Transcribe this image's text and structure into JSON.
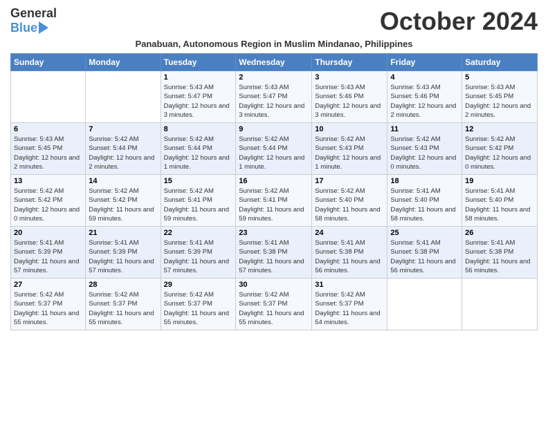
{
  "header": {
    "logo_general": "General",
    "logo_blue": "Blue",
    "month_title": "October 2024",
    "subtitle": "Panabuan, Autonomous Region in Muslim Mindanao, Philippines"
  },
  "days_of_week": [
    "Sunday",
    "Monday",
    "Tuesday",
    "Wednesday",
    "Thursday",
    "Friday",
    "Saturday"
  ],
  "weeks": [
    [
      {
        "day": "",
        "sunrise": "",
        "sunset": "",
        "daylight": ""
      },
      {
        "day": "",
        "sunrise": "",
        "sunset": "",
        "daylight": ""
      },
      {
        "day": "1",
        "sunrise": "Sunrise: 5:43 AM",
        "sunset": "Sunset: 5:47 PM",
        "daylight": "Daylight: 12 hours and 3 minutes."
      },
      {
        "day": "2",
        "sunrise": "Sunrise: 5:43 AM",
        "sunset": "Sunset: 5:47 PM",
        "daylight": "Daylight: 12 hours and 3 minutes."
      },
      {
        "day": "3",
        "sunrise": "Sunrise: 5:43 AM",
        "sunset": "Sunset: 5:46 PM",
        "daylight": "Daylight: 12 hours and 3 minutes."
      },
      {
        "day": "4",
        "sunrise": "Sunrise: 5:43 AM",
        "sunset": "Sunset: 5:46 PM",
        "daylight": "Daylight: 12 hours and 2 minutes."
      },
      {
        "day": "5",
        "sunrise": "Sunrise: 5:43 AM",
        "sunset": "Sunset: 5:45 PM",
        "daylight": "Daylight: 12 hours and 2 minutes."
      }
    ],
    [
      {
        "day": "6",
        "sunrise": "Sunrise: 5:43 AM",
        "sunset": "Sunset: 5:45 PM",
        "daylight": "Daylight: 12 hours and 2 minutes."
      },
      {
        "day": "7",
        "sunrise": "Sunrise: 5:42 AM",
        "sunset": "Sunset: 5:44 PM",
        "daylight": "Daylight: 12 hours and 2 minutes."
      },
      {
        "day": "8",
        "sunrise": "Sunrise: 5:42 AM",
        "sunset": "Sunset: 5:44 PM",
        "daylight": "Daylight: 12 hours and 1 minute."
      },
      {
        "day": "9",
        "sunrise": "Sunrise: 5:42 AM",
        "sunset": "Sunset: 5:44 PM",
        "daylight": "Daylight: 12 hours and 1 minute."
      },
      {
        "day": "10",
        "sunrise": "Sunrise: 5:42 AM",
        "sunset": "Sunset: 5:43 PM",
        "daylight": "Daylight: 12 hours and 1 minute."
      },
      {
        "day": "11",
        "sunrise": "Sunrise: 5:42 AM",
        "sunset": "Sunset: 5:43 PM",
        "daylight": "Daylight: 12 hours and 0 minutes."
      },
      {
        "day": "12",
        "sunrise": "Sunrise: 5:42 AM",
        "sunset": "Sunset: 5:42 PM",
        "daylight": "Daylight: 12 hours and 0 minutes."
      }
    ],
    [
      {
        "day": "13",
        "sunrise": "Sunrise: 5:42 AM",
        "sunset": "Sunset: 5:42 PM",
        "daylight": "Daylight: 12 hours and 0 minutes."
      },
      {
        "day": "14",
        "sunrise": "Sunrise: 5:42 AM",
        "sunset": "Sunset: 5:42 PM",
        "daylight": "Daylight: 11 hours and 59 minutes."
      },
      {
        "day": "15",
        "sunrise": "Sunrise: 5:42 AM",
        "sunset": "Sunset: 5:41 PM",
        "daylight": "Daylight: 11 hours and 59 minutes."
      },
      {
        "day": "16",
        "sunrise": "Sunrise: 5:42 AM",
        "sunset": "Sunset: 5:41 PM",
        "daylight": "Daylight: 11 hours and 59 minutes."
      },
      {
        "day": "17",
        "sunrise": "Sunrise: 5:42 AM",
        "sunset": "Sunset: 5:40 PM",
        "daylight": "Daylight: 11 hours and 58 minutes."
      },
      {
        "day": "18",
        "sunrise": "Sunrise: 5:41 AM",
        "sunset": "Sunset: 5:40 PM",
        "daylight": "Daylight: 11 hours and 58 minutes."
      },
      {
        "day": "19",
        "sunrise": "Sunrise: 5:41 AM",
        "sunset": "Sunset: 5:40 PM",
        "daylight": "Daylight: 11 hours and 58 minutes."
      }
    ],
    [
      {
        "day": "20",
        "sunrise": "Sunrise: 5:41 AM",
        "sunset": "Sunset: 5:39 PM",
        "daylight": "Daylight: 11 hours and 57 minutes."
      },
      {
        "day": "21",
        "sunrise": "Sunrise: 5:41 AM",
        "sunset": "Sunset: 5:39 PM",
        "daylight": "Daylight: 11 hours and 57 minutes."
      },
      {
        "day": "22",
        "sunrise": "Sunrise: 5:41 AM",
        "sunset": "Sunset: 5:39 PM",
        "daylight": "Daylight: 11 hours and 57 minutes."
      },
      {
        "day": "23",
        "sunrise": "Sunrise: 5:41 AM",
        "sunset": "Sunset: 5:38 PM",
        "daylight": "Daylight: 11 hours and 57 minutes."
      },
      {
        "day": "24",
        "sunrise": "Sunrise: 5:41 AM",
        "sunset": "Sunset: 5:38 PM",
        "daylight": "Daylight: 11 hours and 56 minutes."
      },
      {
        "day": "25",
        "sunrise": "Sunrise: 5:41 AM",
        "sunset": "Sunset: 5:38 PM",
        "daylight": "Daylight: 11 hours and 56 minutes."
      },
      {
        "day": "26",
        "sunrise": "Sunrise: 5:41 AM",
        "sunset": "Sunset: 5:38 PM",
        "daylight": "Daylight: 11 hours and 56 minutes."
      }
    ],
    [
      {
        "day": "27",
        "sunrise": "Sunrise: 5:42 AM",
        "sunset": "Sunset: 5:37 PM",
        "daylight": "Daylight: 11 hours and 55 minutes."
      },
      {
        "day": "28",
        "sunrise": "Sunrise: 5:42 AM",
        "sunset": "Sunset: 5:37 PM",
        "daylight": "Daylight: 11 hours and 55 minutes."
      },
      {
        "day": "29",
        "sunrise": "Sunrise: 5:42 AM",
        "sunset": "Sunset: 5:37 PM",
        "daylight": "Daylight: 11 hours and 55 minutes."
      },
      {
        "day": "30",
        "sunrise": "Sunrise: 5:42 AM",
        "sunset": "Sunset: 5:37 PM",
        "daylight": "Daylight: 11 hours and 55 minutes."
      },
      {
        "day": "31",
        "sunrise": "Sunrise: 5:42 AM",
        "sunset": "Sunset: 5:37 PM",
        "daylight": "Daylight: 11 hours and 54 minutes."
      },
      {
        "day": "",
        "sunrise": "",
        "sunset": "",
        "daylight": ""
      },
      {
        "day": "",
        "sunrise": "",
        "sunset": "",
        "daylight": ""
      }
    ]
  ]
}
